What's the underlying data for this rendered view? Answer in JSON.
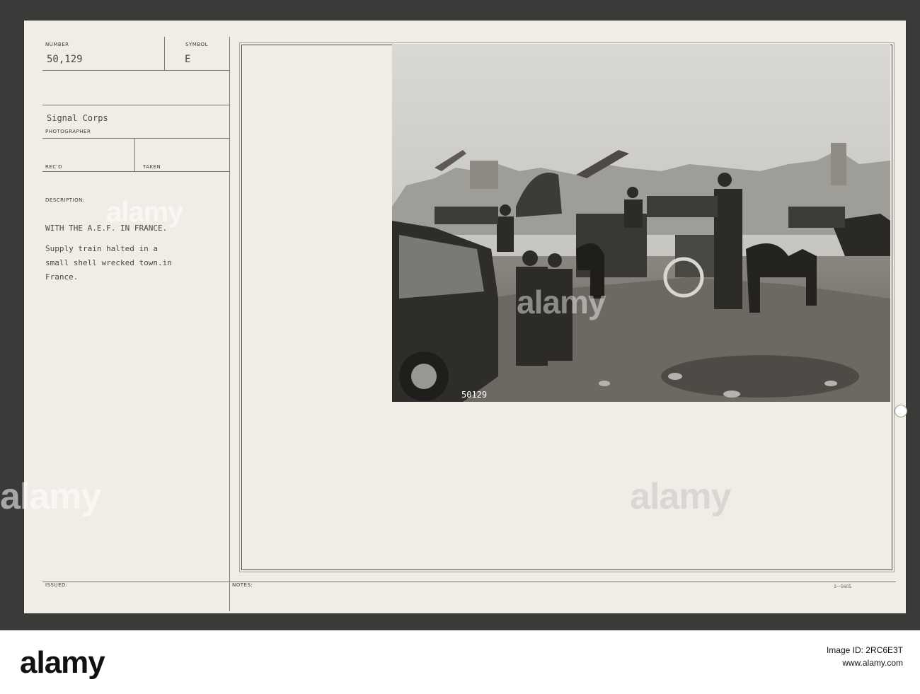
{
  "card": {
    "number_label": "NUMBER",
    "number_value": "50,129",
    "symbol_label": "SYMBOL",
    "symbol_value": "E",
    "photographer_value": "Signal Corps",
    "photographer_label": "PHOTOGRAPHER",
    "recd_label": "REC'D",
    "taken_label": "TAKEN",
    "description_label": "DESCRIPTION:",
    "description_line1": "WITH THE A.E.F. IN FRANCE.",
    "description_line2": "Supply train halted in a",
    "description_line3": "small shell wrecked town.in",
    "description_line4": "France.",
    "issued_label": "ISSUED:",
    "notes_label": "NOTES:",
    "form_number": "3—5605"
  },
  "photo": {
    "negative_number": "50129"
  },
  "watermark": {
    "text": "alamy"
  },
  "footer": {
    "logo": "alamy",
    "image_id": "Image ID: 2RC6E3T",
    "url": "www.alamy.com"
  },
  "colors": {
    "card_bg": "#f1ede6",
    "background": "#3a3a38",
    "photo_tone": "#7d7d79"
  }
}
